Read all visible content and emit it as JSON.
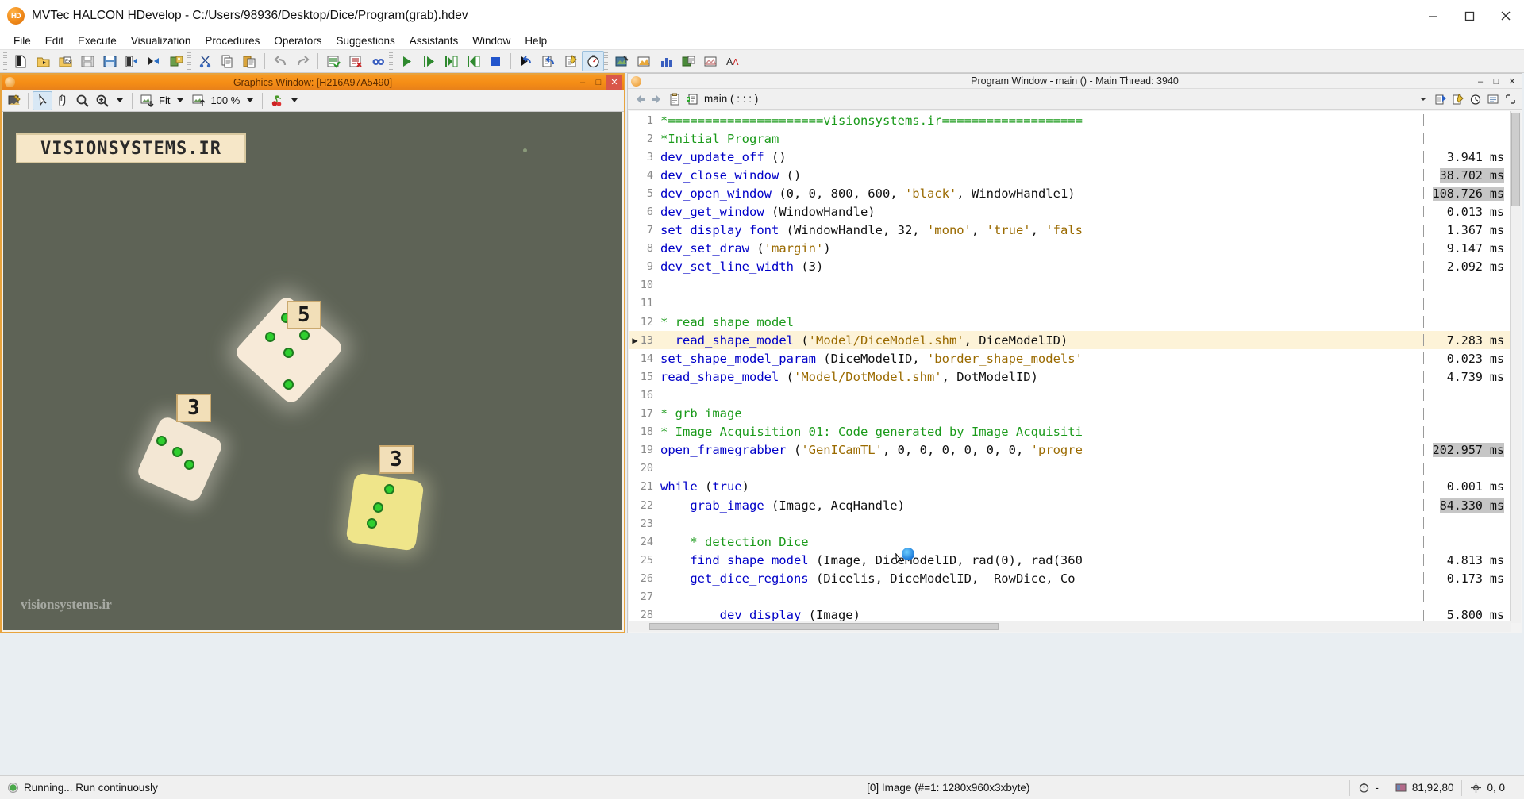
{
  "window": {
    "title": "MVTec HALCON HDevelop - C:/Users/98936/Desktop/Dice/Program(grab).hdev",
    "logo_text": "HD",
    "controls": {
      "minimize": "–",
      "maximize": "□",
      "close": "✕"
    }
  },
  "menubar": {
    "items": [
      "File",
      "Edit",
      "Execute",
      "Visualization",
      "Procedures",
      "Operators",
      "Suggestions",
      "Assistants",
      "Window",
      "Help"
    ]
  },
  "toolbar": {
    "groups": [
      {
        "icons": [
          "new-program-icon",
          "open-program-icon",
          "open-example-icon",
          "save-program-icon",
          "save-as-icon",
          "import-program-icon",
          "export-program-icon",
          "image-acquisition-icon"
        ]
      },
      {
        "icons": [
          "cut-icon",
          "copy-icon",
          "paste-icon",
          "undo-icon",
          "redo-icon",
          "comment-icon",
          "uncomment-icon",
          "find-icon"
        ]
      },
      {
        "icons": [
          "run-icon",
          "step-over-icon",
          "step-into-icon",
          "step-out-icon",
          "stop-icon",
          "reset-program-counter-icon",
          "continue-icon",
          "edit-variables-icon",
          "profiling-icon"
        ]
      },
      {
        "icons": [
          "image-variable-icon",
          "region-variable-icon",
          "histogram-icon",
          "display-image-icon",
          "feature-plot-icon",
          "text-tool-icon"
        ]
      }
    ]
  },
  "graphics_window": {
    "title": "Graphics Window: [H216A97A5490]",
    "controls": {
      "minimize": "–",
      "maximize": "□",
      "close": "✕"
    },
    "toolbar": {
      "draw_mode_icon": "draw-mode-icon",
      "select_icon": "select-arrow-icon",
      "pan_icon": "pan-hand-icon",
      "zoom_icon": "magnifier-icon",
      "zoom_in_icon": "zoom-in-icon",
      "fit_icon": "fit-image-icon",
      "fit_label": "Fit",
      "zoom_level_icon": "zoom-level-icon",
      "zoom_level_label": "100 %",
      "color_icon": "cherry-color-icon"
    },
    "canvas": {
      "overlay_logo": "VISIONSYSTEMS.IR",
      "watermark": "visionsystems.ir",
      "background_color": "#5e6356",
      "dice": [
        {
          "label": "5",
          "pips": 5,
          "color": "#f7ead8"
        },
        {
          "label": "3",
          "pips": 3,
          "color": "#f3e7d4"
        },
        {
          "label": "3",
          "pips": 3,
          "color": "#efe58a"
        }
      ]
    }
  },
  "program_window": {
    "title": "Program Window - main () - Main Thread: 3940",
    "controls": {
      "minimize": "–",
      "maximize": "□",
      "close": "✕"
    },
    "toolbar": {
      "back_icon": "nav-back-icon",
      "forward_icon": "nav-forward-icon",
      "clipboard_icon": "clipboard-icon",
      "procedure_icon": "procedure-icon",
      "procedure_name": "main ( : : : )",
      "dropdown_icon": "chevron-down-icon",
      "right_icons": [
        "insert-operator-icon",
        "edit-icon",
        "clock-icon",
        "settings-icon",
        "expand-icon"
      ]
    },
    "code_lines": [
      {
        "n": 1,
        "tokens": [
          {
            "t": "*=====================visionsystems.ir===================",
            "c": "cmt"
          }
        ],
        "time": ""
      },
      {
        "n": 2,
        "tokens": [
          {
            "t": "*Initial Program",
            "c": "cmt"
          }
        ],
        "time": ""
      },
      {
        "n": 3,
        "tokens": [
          {
            "t": "dev_update_off",
            "c": "kw"
          },
          {
            "t": " ()",
            "c": "plain"
          }
        ],
        "time": "3.941 ms"
      },
      {
        "n": 4,
        "tokens": [
          {
            "t": "dev_close_window",
            "c": "kw"
          },
          {
            "t": " ()",
            "c": "plain"
          }
        ],
        "time": "38.702 ms",
        "time_hl": true
      },
      {
        "n": 5,
        "tokens": [
          {
            "t": "dev_open_window",
            "c": "kw"
          },
          {
            "t": " (0, 0, 800, 600, ",
            "c": "plain"
          },
          {
            "t": "'black'",
            "c": "str"
          },
          {
            "t": ", WindowHandle1)",
            "c": "plain"
          }
        ],
        "time": "108.726 ms",
        "time_hl": true
      },
      {
        "n": 6,
        "tokens": [
          {
            "t": "dev_get_window",
            "c": "kw"
          },
          {
            "t": " (WindowHandle)",
            "c": "plain"
          }
        ],
        "time": "0.013 ms"
      },
      {
        "n": 7,
        "tokens": [
          {
            "t": "set_display_font",
            "c": "kw"
          },
          {
            "t": " (WindowHandle, 32, ",
            "c": "plain"
          },
          {
            "t": "'mono'",
            "c": "str"
          },
          {
            "t": ", ",
            "c": "plain"
          },
          {
            "t": "'true'",
            "c": "str"
          },
          {
            "t": ", ",
            "c": "plain"
          },
          {
            "t": "'fals",
            "c": "str"
          }
        ],
        "time": "1.367 ms"
      },
      {
        "n": 8,
        "tokens": [
          {
            "t": "dev_set_draw",
            "c": "kw"
          },
          {
            "t": " (",
            "c": "plain"
          },
          {
            "t": "'margin'",
            "c": "str"
          },
          {
            "t": ")",
            "c": "plain"
          }
        ],
        "time": "9.147 ms"
      },
      {
        "n": 9,
        "tokens": [
          {
            "t": "dev_set_line_width",
            "c": "kw"
          },
          {
            "t": " (3)",
            "c": "plain"
          }
        ],
        "time": "2.092 ms"
      },
      {
        "n": 10,
        "tokens": [],
        "time": ""
      },
      {
        "n": 11,
        "tokens": [],
        "time": ""
      },
      {
        "n": 12,
        "tokens": [
          {
            "t": "* read shape model",
            "c": "cmt"
          }
        ],
        "time": ""
      },
      {
        "n": 13,
        "tokens": [
          {
            "t": "  ",
            "c": "plain"
          },
          {
            "t": "read_shape_model",
            "c": "kw"
          },
          {
            "t": " (",
            "c": "plain"
          },
          {
            "t": "'Model/DiceModel.shm'",
            "c": "str"
          },
          {
            "t": ", DiceModelID)",
            "c": "plain"
          }
        ],
        "time": "7.283 ms",
        "current": true
      },
      {
        "n": 14,
        "tokens": [
          {
            "t": "set_shape_model_param",
            "c": "kw"
          },
          {
            "t": " (DiceModelID, ",
            "c": "plain"
          },
          {
            "t": "'border_shape_models'",
            "c": "str"
          }
        ],
        "time": "0.023 ms"
      },
      {
        "n": 15,
        "tokens": [
          {
            "t": "read_shape_model",
            "c": "kw"
          },
          {
            "t": " (",
            "c": "plain"
          },
          {
            "t": "'Model/DotModel.shm'",
            "c": "str"
          },
          {
            "t": ", DotModelID)",
            "c": "plain"
          }
        ],
        "time": "4.739 ms"
      },
      {
        "n": 16,
        "tokens": [],
        "time": ""
      },
      {
        "n": 17,
        "tokens": [
          {
            "t": "* grb image",
            "c": "cmt"
          }
        ],
        "time": ""
      },
      {
        "n": 18,
        "tokens": [
          {
            "t": "* Image Acquisition 01: Code generated by Image Acquisiti",
            "c": "cmt"
          }
        ],
        "time": ""
      },
      {
        "n": 19,
        "tokens": [
          {
            "t": "open_framegrabber",
            "c": "kw"
          },
          {
            "t": " (",
            "c": "plain"
          },
          {
            "t": "'GenICamTL'",
            "c": "str"
          },
          {
            "t": ", 0, 0, 0, 0, 0, 0, ",
            "c": "plain"
          },
          {
            "t": "'progre",
            "c": "str"
          }
        ],
        "time": "202.957 ms",
        "time_hl": true
      },
      {
        "n": 20,
        "tokens": [],
        "time": ""
      },
      {
        "n": 21,
        "tokens": [
          {
            "t": "while",
            "c": "kw"
          },
          {
            "t": " (",
            "c": "plain"
          },
          {
            "t": "true",
            "c": "kw"
          },
          {
            "t": ")",
            "c": "plain"
          }
        ],
        "time": "0.001 ms"
      },
      {
        "n": 22,
        "tokens": [
          {
            "t": "    ",
            "c": "plain"
          },
          {
            "t": "grab_image",
            "c": "kw"
          },
          {
            "t": " (Image, AcqHandle)",
            "c": "plain"
          }
        ],
        "time": "84.330 ms",
        "time_hl": true
      },
      {
        "n": 23,
        "tokens": [],
        "time": ""
      },
      {
        "n": 24,
        "tokens": [
          {
            "t": "    * detection Dice",
            "c": "cmt"
          }
        ],
        "time": ""
      },
      {
        "n": 25,
        "tokens": [
          {
            "t": "    ",
            "c": "plain"
          },
          {
            "t": "find_shape_model",
            "c": "kw"
          },
          {
            "t": " (Image, DiceModelID, rad(0), rad(360",
            "c": "plain"
          }
        ],
        "time": "4.813 ms"
      },
      {
        "n": 26,
        "tokens": [
          {
            "t": "    ",
            "c": "plain"
          },
          {
            "t": "get_dice_regions",
            "c": "kw"
          },
          {
            "t": " (Diceli",
            "c": "plain"
          },
          {
            "t": "s",
            "c": "plain"
          },
          {
            "t": ", DiceModelID,  RowDice, Co",
            "c": "plain"
          }
        ],
        "time": "0.173 ms"
      },
      {
        "n": 27,
        "tokens": [],
        "time": ""
      },
      {
        "n": 28,
        "tokens": [
          {
            "t": "        ",
            "c": "plain"
          },
          {
            "t": "dev_display",
            "c": "kw"
          },
          {
            "t": " (Image)",
            "c": "plain"
          }
        ],
        "time": "5.800 ms"
      }
    ]
  },
  "statusbar": {
    "run_status": "Running... Run continuously",
    "image_info": "[0] Image (#=1: 1280x960x3xbyte)",
    "timer": "-",
    "pixel_value": "81,92,80",
    "coordinates": "0, 0",
    "timer_icon": "stopwatch-icon",
    "pixel_icon": "color-swatch-icon",
    "coord_icon": "crosshair-icon"
  }
}
